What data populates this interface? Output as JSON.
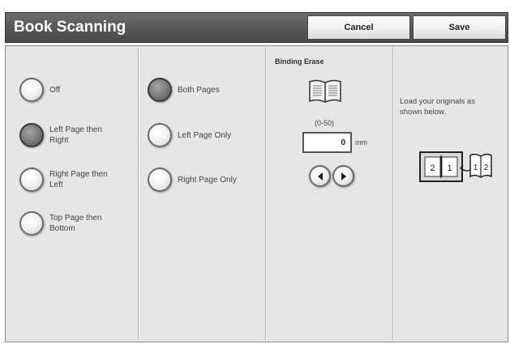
{
  "header": {
    "title": "Book Scanning",
    "cancel_label": "Cancel",
    "save_label": "Save"
  },
  "order_options": [
    {
      "label": "Off",
      "selected": false
    },
    {
      "label": "Left Page then Right",
      "selected": true
    },
    {
      "label": "Right Page then Left",
      "selected": false
    },
    {
      "label": "Top Page then Bottom",
      "selected": false
    }
  ],
  "page_options": [
    {
      "label": "Both Pages",
      "selected": true
    },
    {
      "label": "Left Page Only",
      "selected": false
    },
    {
      "label": "Right Page Only",
      "selected": false
    }
  ],
  "binding_erase": {
    "title": "Binding Erase",
    "range": "(0-50)",
    "value": "0",
    "unit": "mm"
  },
  "info": {
    "text": "Load your originals as shown below."
  },
  "colors": {
    "title_bar": "#5a5a5a",
    "panel": "#e6e6e6",
    "selected_radio": "#6b6b6b"
  }
}
